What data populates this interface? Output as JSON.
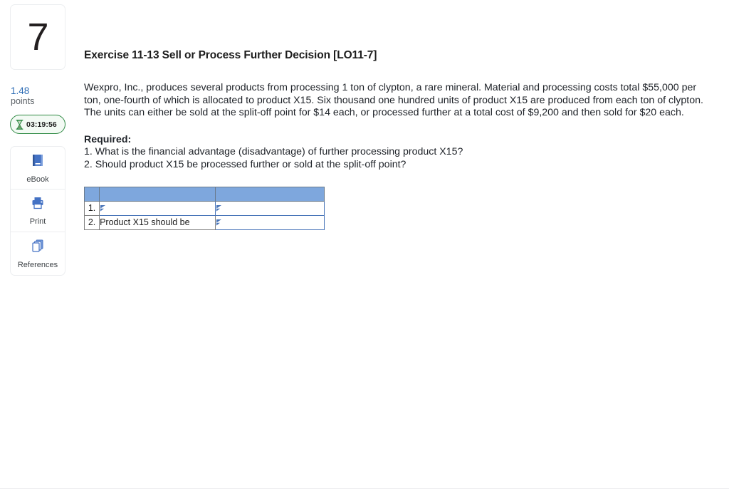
{
  "sidebar": {
    "question_number": "7",
    "points_value": "1.48",
    "points_label": "points",
    "timer": {
      "icon": "hourglass-icon",
      "time": "03:19:56",
      "border_color": "#2f8a44"
    },
    "tools": [
      {
        "icon": "ebook-icon",
        "label": "eBook"
      },
      {
        "icon": "printer-icon",
        "label": "Print"
      },
      {
        "icon": "references-pages-icon",
        "label": "References"
      }
    ]
  },
  "main": {
    "title": "Exercise 11-13 Sell or Process Further Decision [LO11-7]",
    "paragraph": "Wexpro, Inc., produces several products from processing 1 ton of clypton, a rare mineral. Material and processing costs total $55,000 per ton, one-fourth of which is allocated to product X15. Six thousand one hundred units of product X15 are produced from each ton of clypton. The units can either be sold at the split-off point for $14 each, or processed further at a total cost of $9,200 and then sold for $20 each.",
    "required_heading": "Required:",
    "required_items": [
      "1. What is the financial advantage (disadvantage) of further processing product X15?",
      "2. Should product X15 be processed further or sold at the split-off point?"
    ]
  },
  "answer_table": {
    "header_color": "#7ea7dd",
    "header_cells": [
      "",
      "",
      ""
    ],
    "rows": [
      {
        "num": "1.",
        "label": "",
        "label_is_input": true,
        "answer": ""
      },
      {
        "num": "2.",
        "label": "Product X15 should be",
        "label_is_input": false,
        "answer": ""
      }
    ]
  }
}
